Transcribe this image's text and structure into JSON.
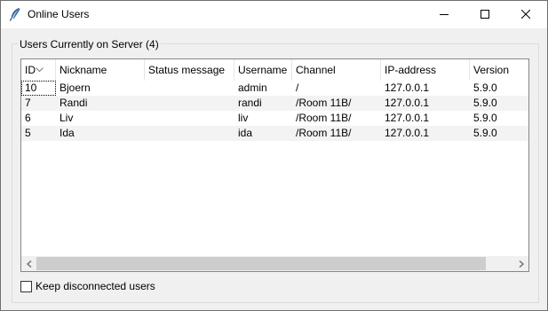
{
  "window": {
    "title": "Online Users",
    "app_icon": "feather-icon",
    "controls": [
      "minimize-icon",
      "maximize-icon",
      "close-icon"
    ]
  },
  "group": {
    "label": "Users Currently on Server (4)"
  },
  "table": {
    "sort_indicator": "sort-down-icon",
    "columns": [
      "ID",
      "Nickname",
      "Status message",
      "Username",
      "Channel",
      "IP-address",
      "Version"
    ],
    "rows": [
      [
        "10",
        "Bjoern",
        "",
        "admin",
        "/",
        "127.0.0.1",
        "5.9.0"
      ],
      [
        "7",
        "Randi",
        "",
        "randi",
        "/Room 11B/",
        "127.0.0.1",
        "5.9.0"
      ],
      [
        "6",
        "Liv",
        "",
        "liv",
        "/Room 11B/",
        "127.0.0.1",
        "5.9.0"
      ],
      [
        "5",
        "Ida",
        "",
        "ida",
        "/Room 11B/",
        "127.0.0.1",
        "5.9.0"
      ]
    ]
  },
  "scrollbar": {
    "left_arrow": "chevron-left-icon",
    "right_arrow": "chevron-right-icon"
  },
  "options": {
    "keep_disconnected_label": "Keep disconnected users",
    "keep_disconnected_checked": false
  }
}
